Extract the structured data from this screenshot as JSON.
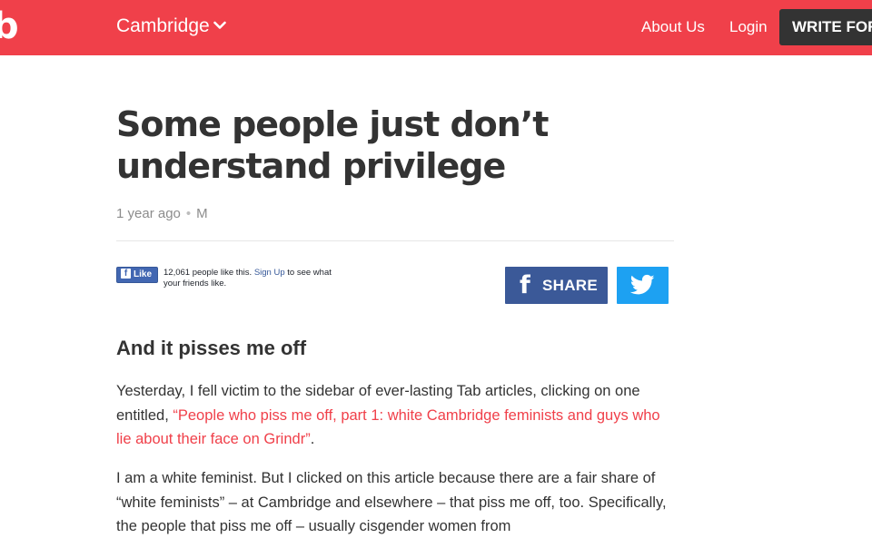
{
  "header": {
    "logo": "b",
    "city": "Cambridge",
    "nav": {
      "about": "About Us",
      "login": "Login",
      "write": "WRITE FOR"
    },
    "colors": {
      "brand": "#f0404a",
      "write_button": "#333333"
    }
  },
  "article": {
    "title": "Some people just don’t understand privilege",
    "meta": {
      "age": "1 year ago",
      "separator": "•",
      "author": "M"
    },
    "facebook_like": {
      "button_label": "Like",
      "count_text": "12,061 people like this.",
      "signup_link": "Sign Up",
      "suffix": "to see what your friends like."
    },
    "share": {
      "facebook_label": "SHARE",
      "colors": {
        "facebook": "#3b5998",
        "twitter": "#1da1f2"
      },
      "icons": [
        "facebook-icon",
        "twitter-icon"
      ]
    },
    "subheading": "And it pisses me off",
    "paragraph_1": {
      "before": "Yesterday,  I fell victim to the sidebar of ever-lasting Tab articles, clicking on one entitled, ",
      "link": "“People who piss me off, part 1: white Cambridge feminists and guys who lie about their face on Grindr”",
      "after": "."
    },
    "paragraph_2": "I am a white feminist.  But I clicked on this article because there are a fair share of “white feminists” – at Cambridge and elsewhere – that piss me off, too.  Specifically, the people that piss me off – usually cisgender women from"
  }
}
